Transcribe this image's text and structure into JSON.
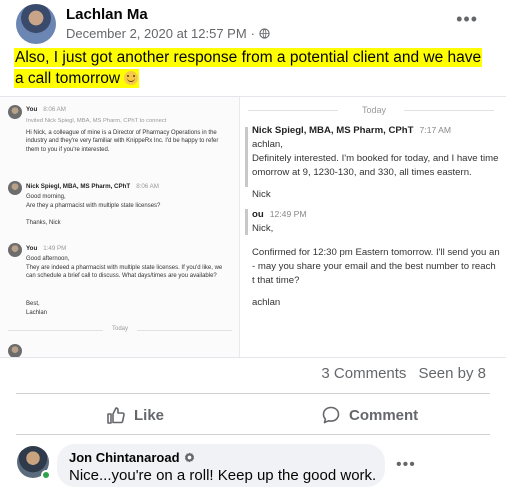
{
  "post": {
    "author": "Lachlan Ma",
    "timestamp": "December 2, 2020 at 12:57 PM",
    "separator": "·",
    "more": "•••",
    "text": "Also, I just got another response from a potential client and we have a call tomorrow",
    "highlight_color": "#ffff00"
  },
  "screenshot_left": {
    "m1_name": "You",
    "m1_time": "8:06 AM",
    "m1_invite": "Invited Nick Spiegl, MBA, MS Pharm, CPhT to connect",
    "m1_body": "Hi Nick, a colleague of mine is a Director of Pharmacy Operations in the industry and they're very familiar with KnippeRx Inc. I'd be happy to refer them to you if you're interested.",
    "m2_name": "Nick Spiegl, MBA, MS Pharm, CPhT",
    "m2_time": "8:06 AM",
    "m2_body1": "Good morning,",
    "m2_body2": "Are they a pharmacist with multiple state licenses?",
    "m2_body3": "Thanks, Nick",
    "m3_name": "You",
    "m3_time": "1:49 PM",
    "m3_body1": "Good afternoon,",
    "m3_body2": "They are indeed a pharmacist with multiple state licenses. If you'd like, we can schedule a brief call to discuss. What days/times are you available?",
    "m3_body3": "Best,",
    "m3_body4": "Lachlan",
    "today": "Today"
  },
  "screenshot_right": {
    "today": "Today",
    "r1_name": "Nick Spiegl, MBA, MS Pharm, CPhT",
    "r1_time": "7:17 AM",
    "r1_l1": "achlan,",
    "r1_l2": "Definitely interested. I'm booked for today, and I have time",
    "r1_l3": "omorrow at 9, 1230-130, and 330, all times eastern.",
    "r1_l4": "Nick",
    "r2_name": "ou",
    "r2_time": "12:49 PM",
    "r2_l1": "Nick,",
    "r2_l2": "Confirmed for 12:30 pm Eastern tomorrow. I'll send you an",
    "r2_l3": "- may you share your email and the best number to reach",
    "r2_l4": "t that time?",
    "r2_l5": "achlan"
  },
  "stats": {
    "comments": "3 Comments",
    "seen": "Seen by 8"
  },
  "actions": {
    "like": "Like",
    "comment": "Comment"
  },
  "comment": {
    "author": "Jon Chintanaroad",
    "text": "Nice...you're on a roll! Keep up the good work.",
    "more": "•••"
  }
}
